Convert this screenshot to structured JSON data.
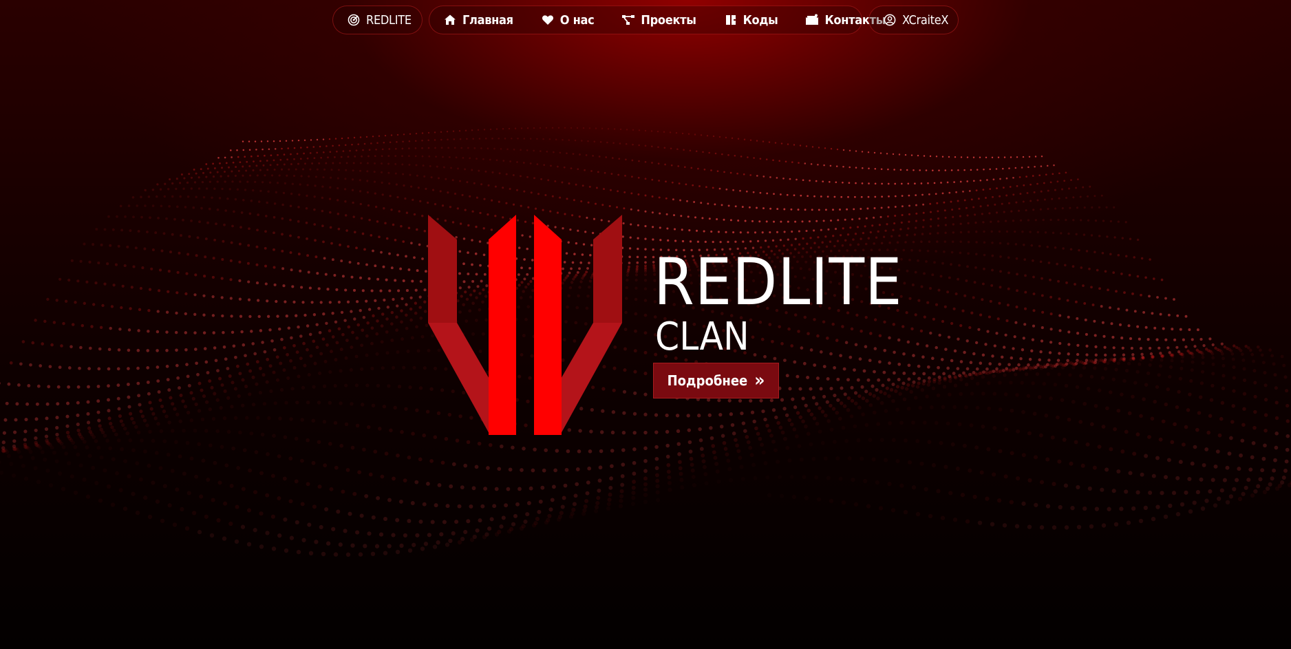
{
  "nav": {
    "brand": {
      "label": "REDLITE",
      "icon": "target-icon"
    },
    "items": [
      {
        "label": "Главная",
        "icon": "home-icon"
      },
      {
        "label": "О нас",
        "icon": "heart-icon"
      },
      {
        "label": "Проекты",
        "icon": "project-icon"
      },
      {
        "label": "Коды",
        "icon": "code-icon"
      },
      {
        "label": "Контакты",
        "icon": "mail-icon"
      }
    ],
    "user": {
      "label": "XCraiteX",
      "icon": "user-icon"
    }
  },
  "hero": {
    "title": "REDLITE",
    "subtitle": "CLAN",
    "button_label": "Подробнее",
    "button_icon": "double-chevron-right-icon"
  },
  "colors": {
    "accent": "#ff0000",
    "accent_dark": "#a00f12",
    "button_bg": "#7a0a10",
    "background": "#050000"
  }
}
